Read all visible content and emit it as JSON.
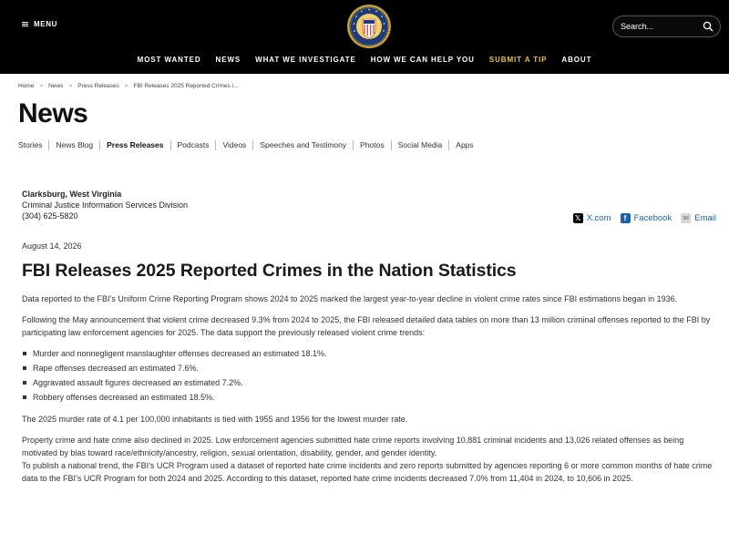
{
  "header": {
    "menu_label": "MENU",
    "search_placeholder": "Search...",
    "nav": [
      {
        "label": "MOST WANTED"
      },
      {
        "label": "NEWS"
      },
      {
        "label": "WHAT WE INVESTIGATE"
      },
      {
        "label": "HOW WE CAN HELP YOU"
      },
      {
        "label": "SUBMIT A TIP"
      },
      {
        "label": "ABOUT"
      }
    ],
    "colors": {
      "background": "#000000",
      "tip_accent": "#e8c44b"
    }
  },
  "breadcrumb": [
    "Home",
    "News",
    "Press Releases",
    "FBI Releases 2025 Reported Crimes i..."
  ],
  "page_title": "News",
  "subnav": [
    "Stories",
    "News Blog",
    "Press Releases",
    "Podcasts",
    "Videos",
    "Speeches and Testimony",
    "Photos",
    "Social Media",
    "Apps"
  ],
  "subnav_active": "Press Releases",
  "contact": {
    "location": "Clarksburg, West Virginia",
    "division": "Criminal Justice Information Services Division",
    "phone": "(304) 625-5820"
  },
  "share": {
    "x": "X.com",
    "facebook": "Facebook",
    "email": "Email"
  },
  "article": {
    "date": "August 14, 2026",
    "headline": "FBI Releases 2025 Reported Crimes in the Nation Statistics",
    "p1": "Data reported to the FBI’s Uniform Crime Reporting Program shows 2024 to 2025 marked the largest year-to-year decline in violent crime rates since FBI estimations began in 1936.",
    "p2": "Following the May announcement that violent crime decreased 9.3% from 2024 to 2025, the FBI released detailed data tables on more than 13 million criminal offenses reported to the FBI by participating law enforcement agencies for 2025. The data support the previously released violent crime trends:",
    "bullets": [
      "Murder and nonnegligent manslaughter offenses decreased an estimated 18.1%.",
      "Rape offenses decreased an estimated 7.6%.",
      "Aggravated assault figures decreased an estimated 7.2%.",
      "Robbery offenses decreased an estimated 18.5%."
    ],
    "p3": "The 2025 murder rate of 4.1 per 100,000 inhabitants is tied with 1955 and 1956 for the lowest murder rate.",
    "p4": "Property crime and hate crime also declined in 2025. Low enforcement agencies submitted hate crime reports involving 10,881 criminal incidents and 13,026 related offenses as being motivated by bias toward race/ethnicity/ancestry, religion, sexual orientation, disability, gender, and gender identity.",
    "p5": "To publish a national trend, the FBI’s UCR Program used a dataset of reported hate crime incidents and zero reports submitted by agencies reporting 6 or more common months of hate crime data to the FBI’s UCR Program for both 2024 and 2025. According to this dataset, reported hate crime incidents decreased 7.0% from 11,404 in 2024, to 10,606 in 2025."
  }
}
